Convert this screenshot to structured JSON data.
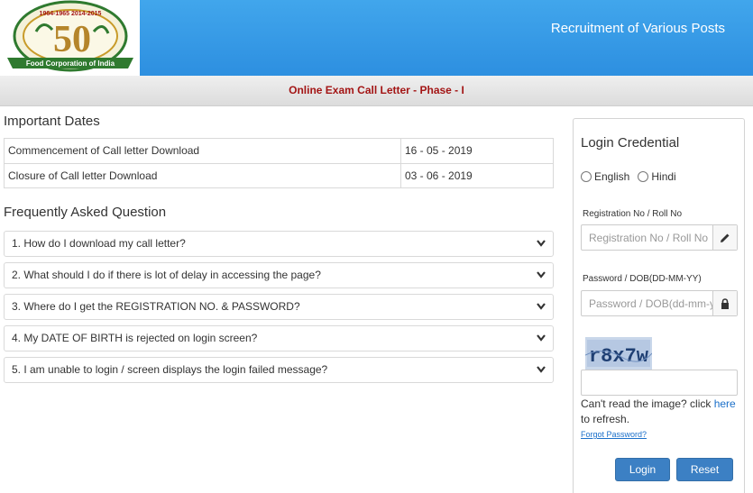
{
  "header": {
    "title": "Recruitment of Various Posts",
    "logo": {
      "years": "1964-1965 2014-2015",
      "number": "50",
      "ribbon": "Food Corporation of India"
    }
  },
  "subbar": {
    "title": "Online Exam Call Letter - Phase - I"
  },
  "important_dates": {
    "title": "Important Dates",
    "rows": [
      {
        "label": "Commencement of Call letter Download",
        "value": "16 - 05 - 2019"
      },
      {
        "label": "Closure of Call letter Download",
        "value": "03 - 06 - 2019"
      }
    ]
  },
  "faq": {
    "title": "Frequently Asked Question",
    "items": [
      "1. How do I download my call letter?",
      "2. What should I do if there is lot of delay in accessing the page?",
      "3. Where do I get the REGISTRATION NO. & PASSWORD?",
      "4. My DATE OF BIRTH is rejected on login screen?",
      "5. I am unable to login / screen displays the login failed message?"
    ]
  },
  "login": {
    "title": "Login Credential",
    "languages": [
      "English",
      "Hindi"
    ],
    "reg_label": "Registration No / Roll No",
    "reg_placeholder": "Registration No / Roll No",
    "pwd_label": "Password / DOB(DD-MM-YY)",
    "pwd_placeholder": "Password / DOB(dd-mm-yy)",
    "captcha_text": "r8x7w",
    "refresh_prefix": "Can't read the image? click ",
    "refresh_link": "here",
    "refresh_suffix": " to refresh.",
    "forgot": "Forgot Password?",
    "login_button": "Login",
    "reset_button": "Reset",
    "icons": {
      "reg": "pencil-icon",
      "pwd": "lock-icon"
    }
  },
  "colors": {
    "header_blue": "#2d8fe0",
    "subtitle_red": "#a31515",
    "button_blue": "#3c80c4",
    "link_blue": "#1a6fc9"
  }
}
